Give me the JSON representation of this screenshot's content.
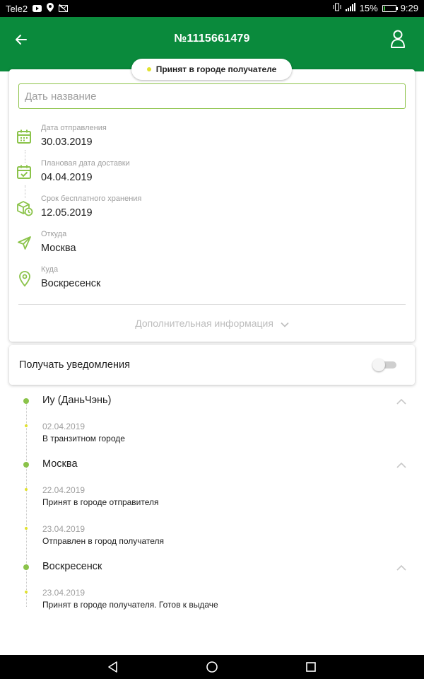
{
  "status_bar": {
    "carrier": "Tele2",
    "battery_percent": "15%",
    "battery_level": 0.15,
    "time": "9:29"
  },
  "app_bar": {
    "title": "№1115661479",
    "back_icon": "arrow-left-icon",
    "profile_icon": "user-icon"
  },
  "status_chip": {
    "label": "Принят в городе получателе",
    "dot_color": "#e1e22e"
  },
  "name_field": {
    "placeholder": "Дать название",
    "value": ""
  },
  "details": [
    {
      "icon": "calendar-icon",
      "label": "Дата отправления",
      "value": "30.03.2019"
    },
    {
      "icon": "calendar-check-icon",
      "label": "Плановая дата доставки",
      "value": "04.04.2019"
    },
    {
      "icon": "box-clock-icon",
      "label": "Срок бесплатного хранения",
      "value": "12.05.2019"
    },
    {
      "icon": "send-icon",
      "label": "Откуда",
      "value": "Москва"
    },
    {
      "icon": "location-pin-icon",
      "label": "Куда",
      "value": "Воскресенск"
    }
  ],
  "more_info": {
    "label": "Дополнительная информация"
  },
  "notifications": {
    "label": "Получать уведомления",
    "enabled": false
  },
  "timeline": [
    {
      "city": "Иу (ДаньЧэнь)",
      "events": [
        {
          "date": "02.04.2019",
          "status": "В транзитном городе"
        }
      ]
    },
    {
      "city": "Москва",
      "events": [
        {
          "date": "22.04.2019",
          "status": "Принят в городе отправителя"
        },
        {
          "date": "23.04.2019",
          "status": "Отправлен в город получателя"
        }
      ]
    },
    {
      "city": "Воскресенск",
      "events": [
        {
          "date": "23.04.2019",
          "status": "Принят в городе получателя. Готов к выдаче"
        }
      ]
    }
  ],
  "colors": {
    "brand_green": "#0a8a3c",
    "accent_green": "#8bc34a",
    "status_yellow": "#e1e22e"
  }
}
